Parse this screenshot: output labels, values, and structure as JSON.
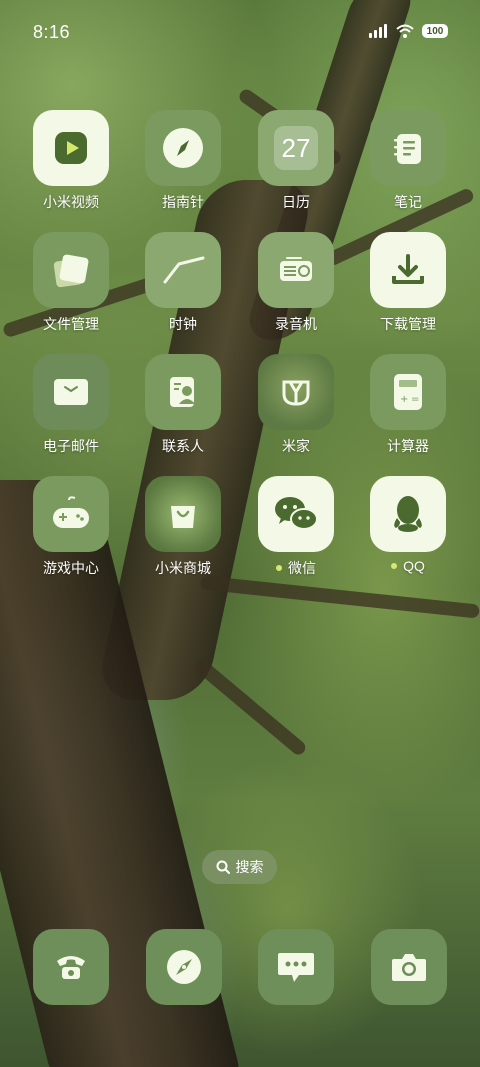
{
  "status_bar": {
    "time": "8:16",
    "battery": "100"
  },
  "apps": [
    {
      "label": "小米视频",
      "icon": "video-icon"
    },
    {
      "label": "指南针",
      "icon": "compass-icon"
    },
    {
      "label": "日历",
      "icon": "calendar-icon",
      "badge_text": "27"
    },
    {
      "label": "笔记",
      "icon": "notes-icon"
    },
    {
      "label": "文件管理",
      "icon": "folder-icon"
    },
    {
      "label": "时钟",
      "icon": "clock-icon"
    },
    {
      "label": "录音机",
      "icon": "recorder-icon"
    },
    {
      "label": "下载管理",
      "icon": "download-icon"
    },
    {
      "label": "电子邮件",
      "icon": "mail-icon"
    },
    {
      "label": "联系人",
      "icon": "contacts-icon"
    },
    {
      "label": "米家",
      "icon": "mijia-icon"
    },
    {
      "label": "计算器",
      "icon": "calculator-icon"
    },
    {
      "label": "游戏中心",
      "icon": "gamepad-icon"
    },
    {
      "label": "小米商城",
      "icon": "shopping-bag-icon"
    },
    {
      "label": "微信",
      "icon": "wechat-icon"
    },
    {
      "label": "QQ",
      "icon": "qq-icon"
    }
  ],
  "search": {
    "label": "搜索"
  },
  "dock": [
    {
      "icon": "phone-icon"
    },
    {
      "icon": "browser-compass-icon"
    },
    {
      "icon": "messages-icon"
    },
    {
      "icon": "camera-icon"
    }
  ]
}
